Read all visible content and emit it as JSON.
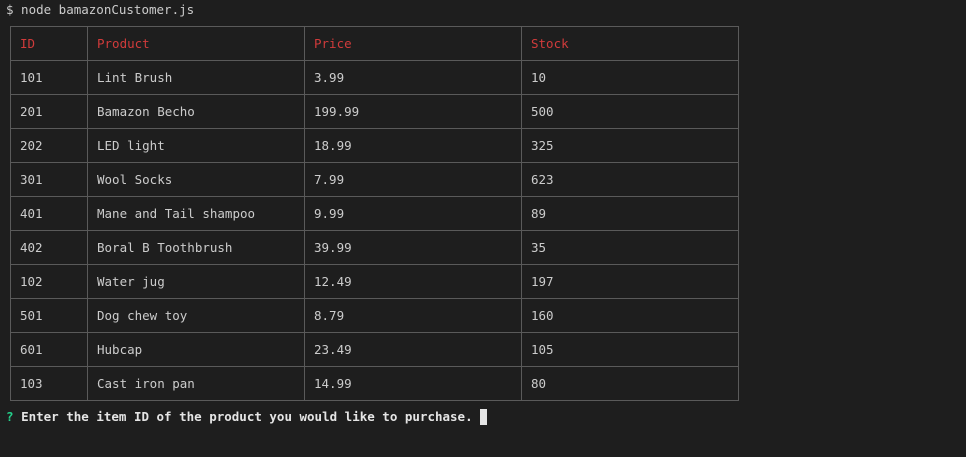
{
  "terminal": {
    "command": "$ node bamazonCustomer.js",
    "prompt_symbol": "?",
    "prompt_text": "Enter the item ID of the product you would like to purchase."
  },
  "table": {
    "headers": [
      "ID",
      "Product",
      "Price",
      "Stock"
    ],
    "rows": [
      [
        "101",
        "Lint Brush",
        "3.99",
        "10"
      ],
      [
        "201",
        "Bamazon Becho",
        "199.99",
        "500"
      ],
      [
        "202",
        "LED light",
        "18.99",
        "325"
      ],
      [
        "301",
        "Wool Socks",
        "7.99",
        "623"
      ],
      [
        "401",
        "Mane and Tail shampoo",
        "9.99",
        "89"
      ],
      [
        "402",
        "Boral B Toothbrush",
        "39.99",
        "35"
      ],
      [
        "102",
        "Water jug",
        "12.49",
        "197"
      ],
      [
        "501",
        "Dog chew toy",
        "8.79",
        "160"
      ],
      [
        "601",
        "Hubcap",
        "23.49",
        "105"
      ],
      [
        "103",
        "Cast iron pan",
        "14.99",
        "80"
      ]
    ]
  },
  "colors": {
    "background": "#1e1e1e",
    "text": "#cccccc",
    "header_text": "#d13b3b",
    "prompt_mark": "#23d18b",
    "border": "#5a5a5a"
  }
}
